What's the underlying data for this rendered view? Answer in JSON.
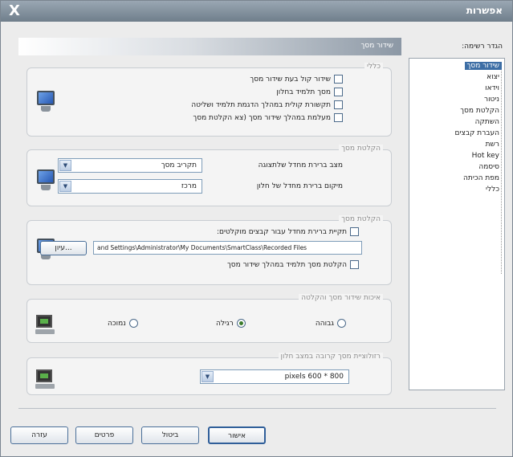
{
  "window": {
    "title": "אפשרות",
    "close": "X"
  },
  "tree": {
    "label": "הגדר רשימה:",
    "items": [
      "שידור מסך",
      "יצוא",
      "וידאו",
      "ניטור",
      "הקלטת מסך",
      "השתקה",
      "העברת קבצים",
      "רשת",
      "Hot key",
      "סיסמה",
      "מפת הכיתה",
      "כללי"
    ],
    "selected_index": 0
  },
  "panel": {
    "header": "שידור מסך",
    "general": {
      "title": "כללי",
      "options": [
        {
          "label": "שידור קול בעת שידור מסך",
          "checked": false
        },
        {
          "label": "מסך תלמיד בחלון",
          "checked": false
        },
        {
          "label": "תקשורת קולית במהלך הדגמת תלמיד ושליטה",
          "checked": false
        },
        {
          "label": "מעלמת במהלך שידור מסך (צא  הקלטת מסך",
          "checked": false
        }
      ]
    },
    "screen_record": {
      "title": "הקלטת מסך",
      "fields": [
        {
          "label": "מצב ברירת מחדל שלתצוגה",
          "value": "תקריב מסך"
        },
        {
          "label": "מיקום ברירת מחדל של חלון",
          "value": "מרכז"
        }
      ]
    },
    "recording": {
      "title": "הקלטת מסך",
      "auto_record_label": "תקיית ברירת מחדל עבור קבצים מוקלטים:",
      "auto_record_checked": false,
      "path": "and Settings\\Administrator\\My Documents\\SmartClass\\Recorded Files",
      "browse_label": "עיון...",
      "record_student_label": "הקלטת מסך תלמיד במהלך שידור מסך",
      "record_student_checked": false
    },
    "quality": {
      "title": "איכות שידור מסך והקלטה",
      "options": [
        {
          "label": "גבוהה",
          "selected": false
        },
        {
          "label": "רגילה",
          "selected": true
        },
        {
          "label": "נמוכה",
          "selected": false
        }
      ]
    },
    "resolution": {
      "title": "רזולוציית מסך קרובה במצב חלון",
      "value": "pixels 600 * 800"
    }
  },
  "buttons": {
    "ok": "אישור",
    "cancel": "ביטול",
    "apply": "פרטים",
    "help": "עזרה"
  },
  "colors": {
    "titlebar": "#7f8d9a",
    "selection": "#3d6ea5",
    "group_title": "#8d8d8d"
  }
}
